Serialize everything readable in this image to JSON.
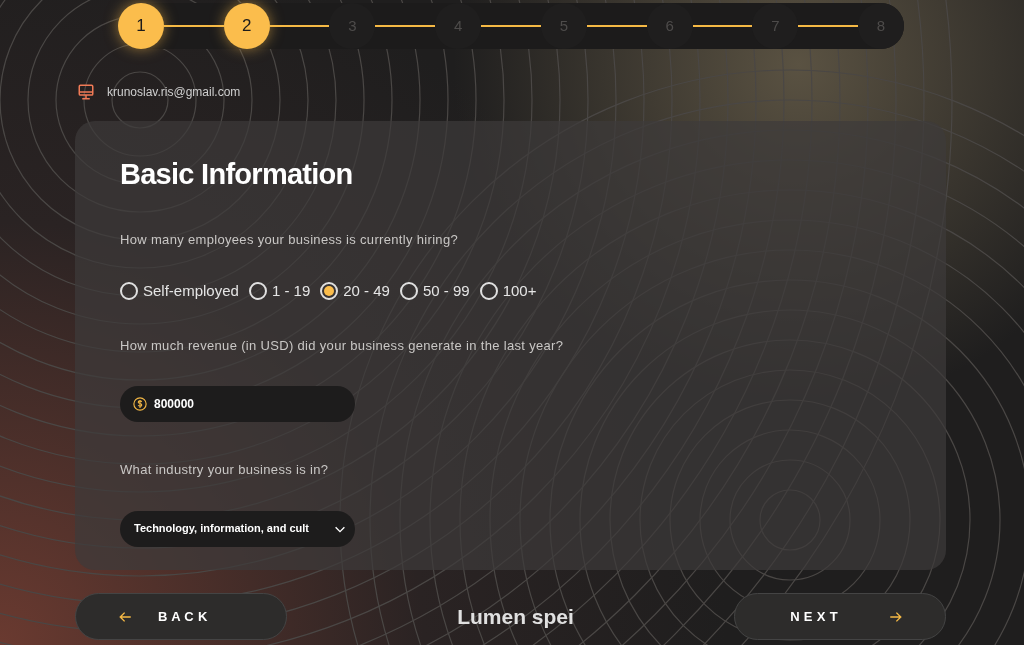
{
  "stepper": {
    "steps": [
      {
        "label": "1",
        "done": true
      },
      {
        "label": "2",
        "done": true
      },
      {
        "label": "3",
        "done": false
      },
      {
        "label": "4",
        "done": false
      },
      {
        "label": "5",
        "done": false
      },
      {
        "label": "6",
        "done": false
      },
      {
        "label": "7",
        "done": false
      },
      {
        "label": "8",
        "done": false
      }
    ]
  },
  "account": {
    "email": "krunoslav.ris@gmail.com"
  },
  "form": {
    "title": "Basic Information",
    "employees": {
      "question": "How many employees your business is currently hiring?",
      "options": [
        {
          "label": "Self-employed",
          "selected": false
        },
        {
          "label": "1 - 19",
          "selected": false
        },
        {
          "label": "20 - 49",
          "selected": true
        },
        {
          "label": "50 - 99",
          "selected": false
        },
        {
          "label": "100+",
          "selected": false
        }
      ]
    },
    "revenue": {
      "question": "How much revenue (in USD) did your business generate in the last year?",
      "value": "800000"
    },
    "industry": {
      "question": "What industry your business is in?",
      "value": "Technology, information, and cult"
    }
  },
  "footer": {
    "back": "B A C K",
    "logo": "Lumen spei",
    "next": "N E X T"
  }
}
